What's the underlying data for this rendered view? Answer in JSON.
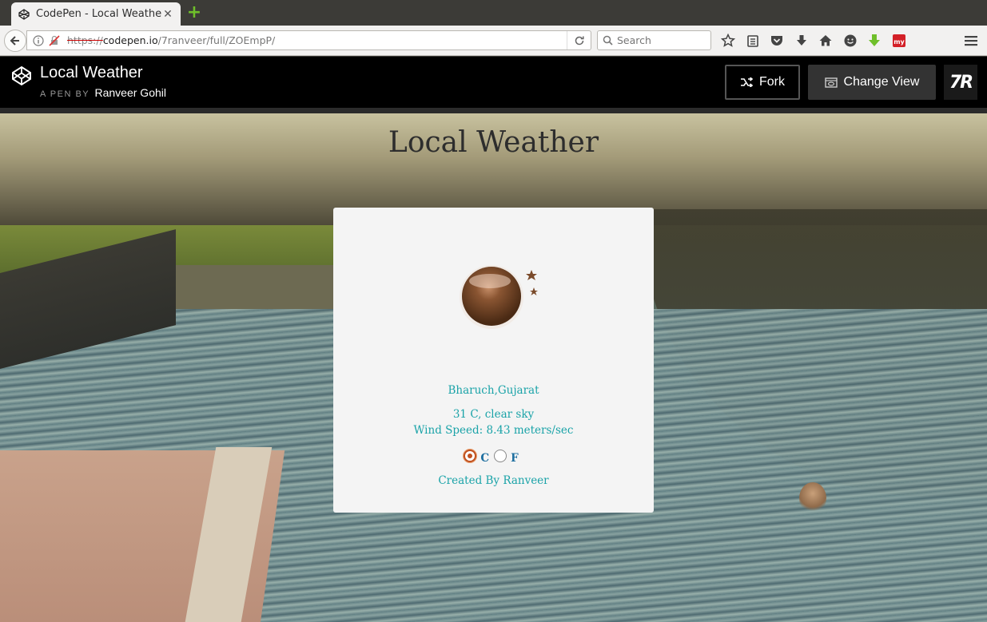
{
  "browser": {
    "tab_title": "CodePen - Local Weather",
    "url_scheme": "https://",
    "url_host": "codepen.io",
    "url_path": "/7ranveer/full/ZOEmpP/",
    "search_placeholder": "Search"
  },
  "codepen": {
    "pen_title": "Local Weather",
    "pen_by": "A PEN BY",
    "author": "Ranveer Gohil",
    "fork_label": "Fork",
    "change_view_label": "Change View",
    "avatar_text": "7R"
  },
  "app": {
    "heading": "Local Weather",
    "weather_icon": "moon-night-icon",
    "location": "Bharuch,Gujarat",
    "condition": "31 C, clear sky",
    "wind": "Wind Speed: 8.43 meters/sec",
    "unit_c": "C",
    "unit_f": "F",
    "selected_unit": "C",
    "credit": "Created By Ranveer"
  },
  "colors": {
    "accent_teal": "#1aa3a8",
    "unit_blue": "#1e6fa0",
    "header_bg": "#000000"
  }
}
